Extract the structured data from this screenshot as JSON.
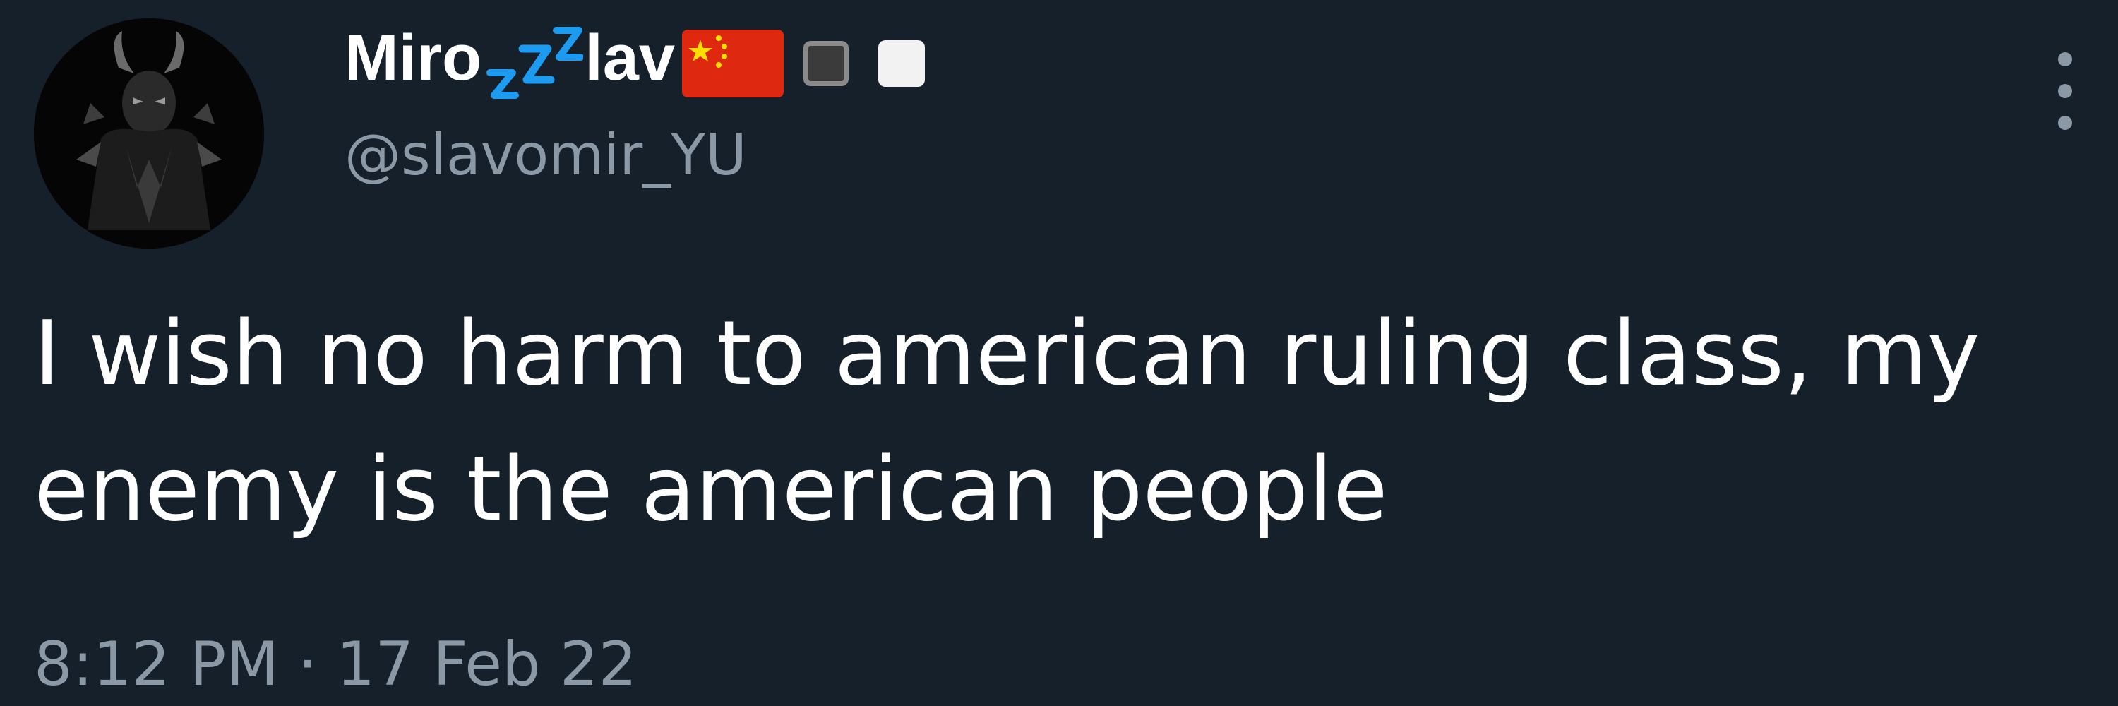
{
  "tweet": {
    "author": {
      "name_part_1": "Miro",
      "name_emoji": "zzz-sleeping-emoji",
      "name_part_2": "lav",
      "badges": [
        "china-flag-emoji",
        "black-square-emoji",
        "white-square-emoji"
      ],
      "handle": "@slavomir_YU"
    },
    "text": "I wish no harm to american ruling class, my\nenemy is the american people",
    "timestamp": "8:12 PM · 17 Feb 22",
    "colors": {
      "background": "#15202b",
      "primary_text": "#ffffff",
      "secondary_text": "#8b98a5",
      "zzz_emoji": "#1d9bf0",
      "flag_red": "#de2910",
      "flag_yellow": "#ffde00"
    },
    "icons": {
      "avatar": "profile-avatar",
      "more": "more-options-icon"
    }
  }
}
